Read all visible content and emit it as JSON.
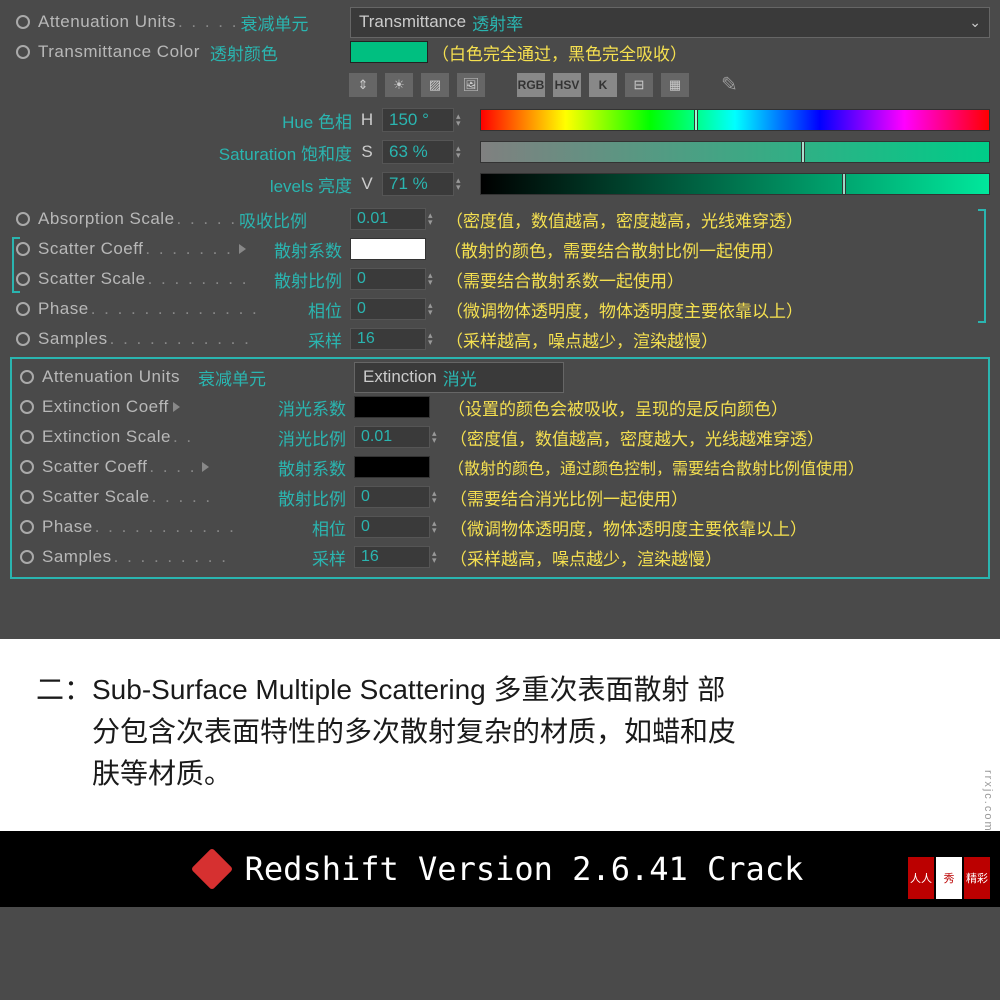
{
  "rows": {
    "attUnits1": {
      "en": "Attenuation Units",
      "dots": ". . . . .",
      "cn": "衰减单元",
      "dropEn": "Transmittance",
      "dropCn": "透射率"
    },
    "transColor": {
      "en": "Transmittance Color",
      "cn": "透射颜色",
      "swatch": "#00bf80",
      "hint": "（白色完全通过，黑色完全吸收）"
    },
    "hue": {
      "label": "Hue 色相",
      "letter": "H",
      "val": "150 °",
      "pos": "42%"
    },
    "sat": {
      "label": "Saturation 饱和度",
      "letter": "S",
      "val": "63 %",
      "pos": "63%"
    },
    "lev": {
      "label": "levels 亮度",
      "letter": "V",
      "val": "71 %",
      "pos": "71%"
    },
    "absScale": {
      "en": "Absorption Scale",
      "dots": ". . . . .",
      "cn": "吸收比例",
      "val": "0.01",
      "hint": "（密度值，数值越高，密度越高，光线难穿透）"
    },
    "scatCoeff1": {
      "en": "Scatter Coeff",
      "dots": ". . . . . . .",
      "cn": "散射系数",
      "hint": "（散射的颜色，需要结合散射比例一起使用）"
    },
    "scatScale1": {
      "en": "Scatter Scale",
      "dots": ". . . . . . . .",
      "cn": "散射比例",
      "val": "0",
      "hint": "（需要结合散射系数一起使用）"
    },
    "phase1": {
      "en": "Phase",
      "dots": " . . . . . . . . . . . . .",
      "cn": "相位",
      "val": "0",
      "hint": "（微调物体透明度，物体透明度主要依靠以上）"
    },
    "samples1": {
      "en": "Samples",
      "dots": " . . . . . . . . . . .",
      "cn": "采样",
      "val": "16",
      "hint": "（采样越高，噪点越少，渲染越慢）"
    },
    "attUnits2": {
      "en": "Attenuation Units",
      "cn": "衰减单元",
      "dropEn": "Extinction",
      "dropCn": "消光"
    },
    "extCoeff": {
      "en": "Extinction Coeff",
      "cn": "消光系数",
      "hint": "（设置的颜色会被吸收，呈现的是反向颜色）"
    },
    "extScale": {
      "en": "Extinction Scale",
      "dots": " . .",
      "cn": "消光比例",
      "val": "0.01",
      "hint": "（密度值，数值越高，密度越大，光线越难穿透）"
    },
    "scatCoeff2": {
      "en": "Scatter Coeff",
      "dots": ". . . .",
      "cn": "散射系数",
      "hint": "（散射的颜色，通过颜色控制，需要结合散射比例值使用）"
    },
    "scatScale2": {
      "en": "Scatter Scale",
      "dots": ". . . . .",
      "cn": "散射比例",
      "val": "0",
      "hint": "（需要结合消光比例一起使用）"
    },
    "phase2": {
      "en": "Phase",
      "dots": " . . . . . . . . . . .",
      "cn": "相位",
      "val": "0",
      "hint": "（微调物体透明度，物体透明度主要依靠以上）"
    },
    "samples2": {
      "en": "Samples",
      "dots": " . . . . . . . . .",
      "cn": "采样",
      "val": "16",
      "hint": "（采样越高，噪点越少，渲染越慢）"
    }
  },
  "toolbar": {
    "rgb": "RGB",
    "hsv": "HSV",
    "k": "K"
  },
  "whiteSection": {
    "line1": "二：Sub-Surface Multiple Scattering 多重次表面散射 部",
    "line2": "分包含次表面特性的多次散射复杂的材质，如蜡和皮",
    "line3": "肤等材质。"
  },
  "footer": {
    "text": "Redshift Version 2.6.41 Crack"
  },
  "sideText": "rrxjc.com rrxjc.com",
  "badge": {
    "a": "人人",
    "b": "秀",
    "c": "精彩"
  }
}
